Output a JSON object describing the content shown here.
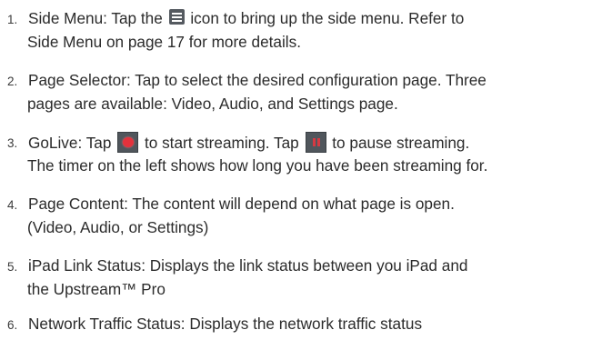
{
  "items": [
    {
      "number": "1.",
      "line1_pre": "Side Menu: Tap the",
      "icon": "menu-icon",
      "line1_post": "icon to bring up the side menu. Refer to",
      "line2": "Side Menu on page 17 for more details."
    },
    {
      "number": "2.",
      "line1": "Page Selector: Tap to select the desired configuration page. Three",
      "line2": "pages are available: Video, Audio, and Settings page."
    },
    {
      "number": "3.",
      "line1_pre": "GoLive: Tap",
      "icon_start": "record-icon",
      "line1_mid": "to start streaming. Tap",
      "icon_pause": "pause-icon",
      "line1_post": "to pause streaming.",
      "line2": "The timer on the left shows how long you have been streaming for."
    },
    {
      "number": "4.",
      "line1": "Page Content: The content will depend on what page is open.",
      "line2": "(Video, Audio, or Settings)"
    },
    {
      "number": "5.",
      "line1": "iPad Link Status: Displays the link status between you iPad and",
      "line2": "the Upstream™ Pro"
    },
    {
      "number": "6.",
      "line1": "Network Traffic Status: Displays the network traffic status"
    }
  ],
  "colors": {
    "text": "#2b2b2b",
    "icon_background": "#50565c",
    "record_red": "#e3323c"
  }
}
